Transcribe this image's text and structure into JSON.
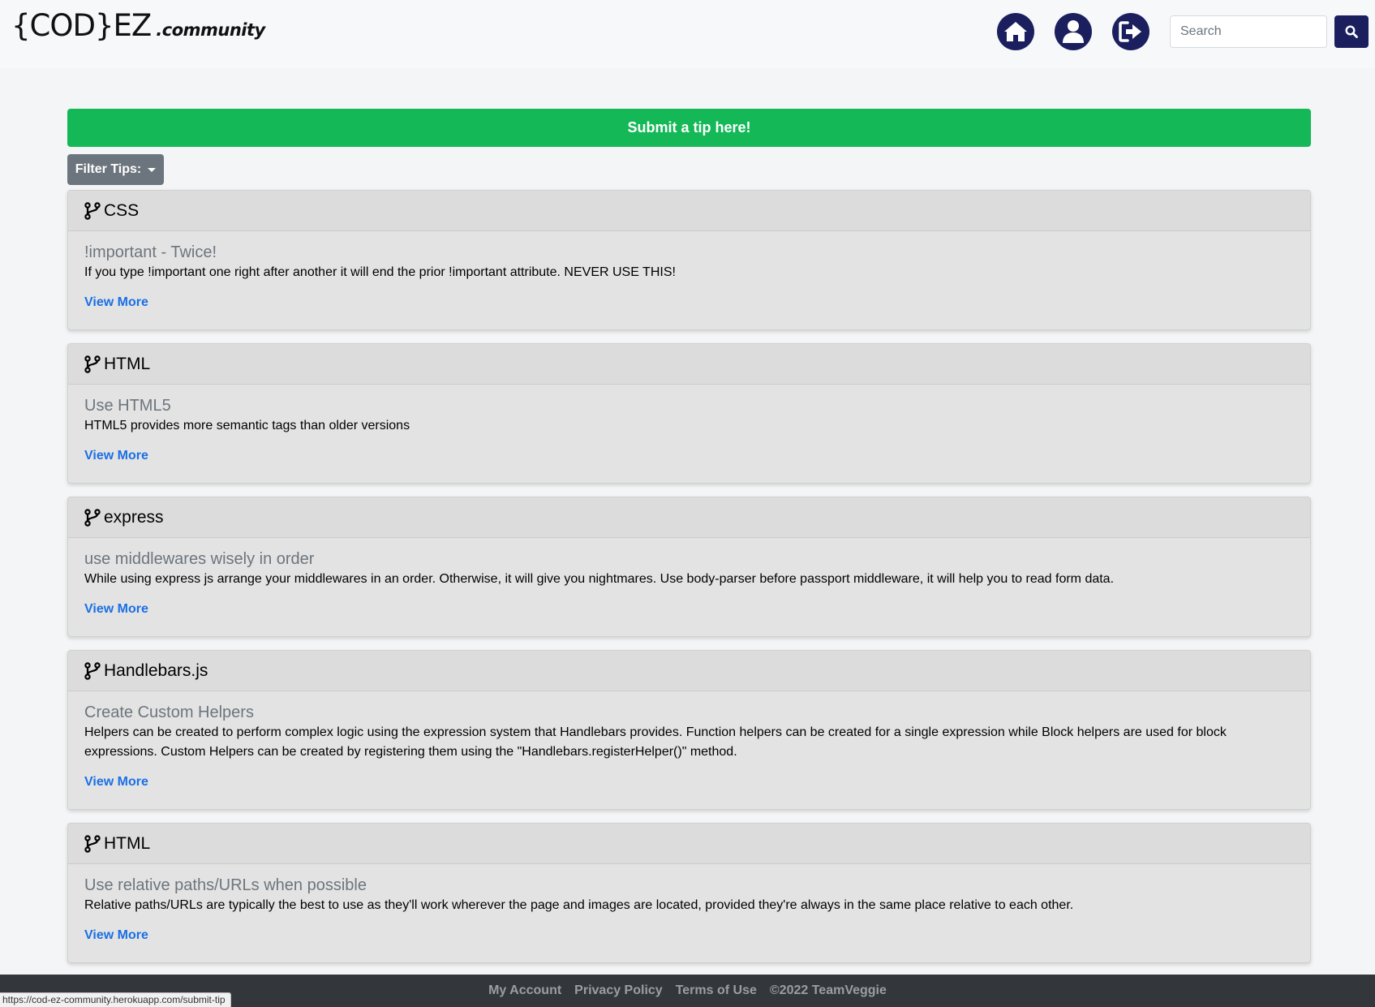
{
  "header": {
    "logo_main": "{COD}EZ",
    "logo_sub": ".community",
    "search_placeholder": "Search"
  },
  "actions": {
    "submit_label": "Submit a tip here!",
    "filter_label": "Filter Tips:"
  },
  "tips": [
    {
      "category": "CSS",
      "title": "!important - Twice!",
      "text": "If you type !important one right after another it will end the prior !important attribute. NEVER USE THIS!",
      "link": "View More"
    },
    {
      "category": "HTML",
      "title": "Use HTML5",
      "text": "HTML5 provides more semantic tags than older versions",
      "link": "View More"
    },
    {
      "category": "express",
      "title": "use middlewares wisely in order",
      "text": "While using express js arrange your middlewares in an order. Otherwise, it will give you nightmares. Use body-parser before passport middleware, it will help you to read form data.",
      "link": "View More"
    },
    {
      "category": "Handlebars.js",
      "title": "Create Custom Helpers",
      "text": "Helpers can be created to perform complex logic using the expression system that Handlebars provides. Function helpers can be created for a single expression while Block helpers are used for block expressions. Custom Helpers can be created by registering them using the \"Handlebars.registerHelper()\" method.",
      "link": "View More"
    },
    {
      "category": "HTML",
      "title": "Use relative paths/URLs when possible",
      "text": "Relative paths/URLs are typically the best to use as they'll work wherever the page and images are located, provided they're always in the same place relative to each other.",
      "link": "View More"
    }
  ],
  "footer": {
    "my_account": "My Account",
    "privacy": "Privacy Policy",
    "terms": "Terms of Use",
    "copyright": "©2022 TeamVeggie"
  },
  "status_bar": {
    "url": "https://cod-ez-community.herokuapp.com/submit-tip"
  },
  "colors": {
    "navy": "#1b1f5e",
    "submit_green": "#14b857",
    "filter_gray": "#6c757d",
    "link_blue": "#1a6fe6"
  }
}
